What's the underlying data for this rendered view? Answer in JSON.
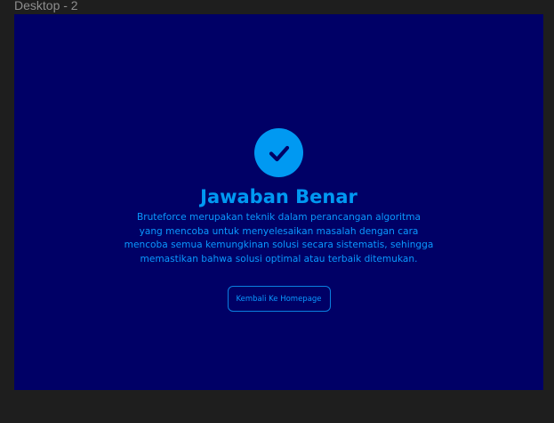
{
  "frame": {
    "label": "Desktop - 2"
  },
  "icons": {
    "status": "check-circle-icon"
  },
  "result": {
    "title": "Jawaban Benar",
    "description_lines": [
      "Bruteforce merupakan teknik dalam perancangan algoritma",
      "yang mencoba untuk menyelesaikan masalah dengan cara",
      "mencoba semua kemungkinan solusi secara sistematis, sehingga",
      "memastikan bahwa solusi optimal atau terbaik ditemukan."
    ],
    "button_label": "Kembali Ke Homepage"
  },
  "colors": {
    "canvas": "#1e1e1e",
    "frame_background": "#000066",
    "accent": "#0099f2",
    "text": "#0a99ff"
  }
}
